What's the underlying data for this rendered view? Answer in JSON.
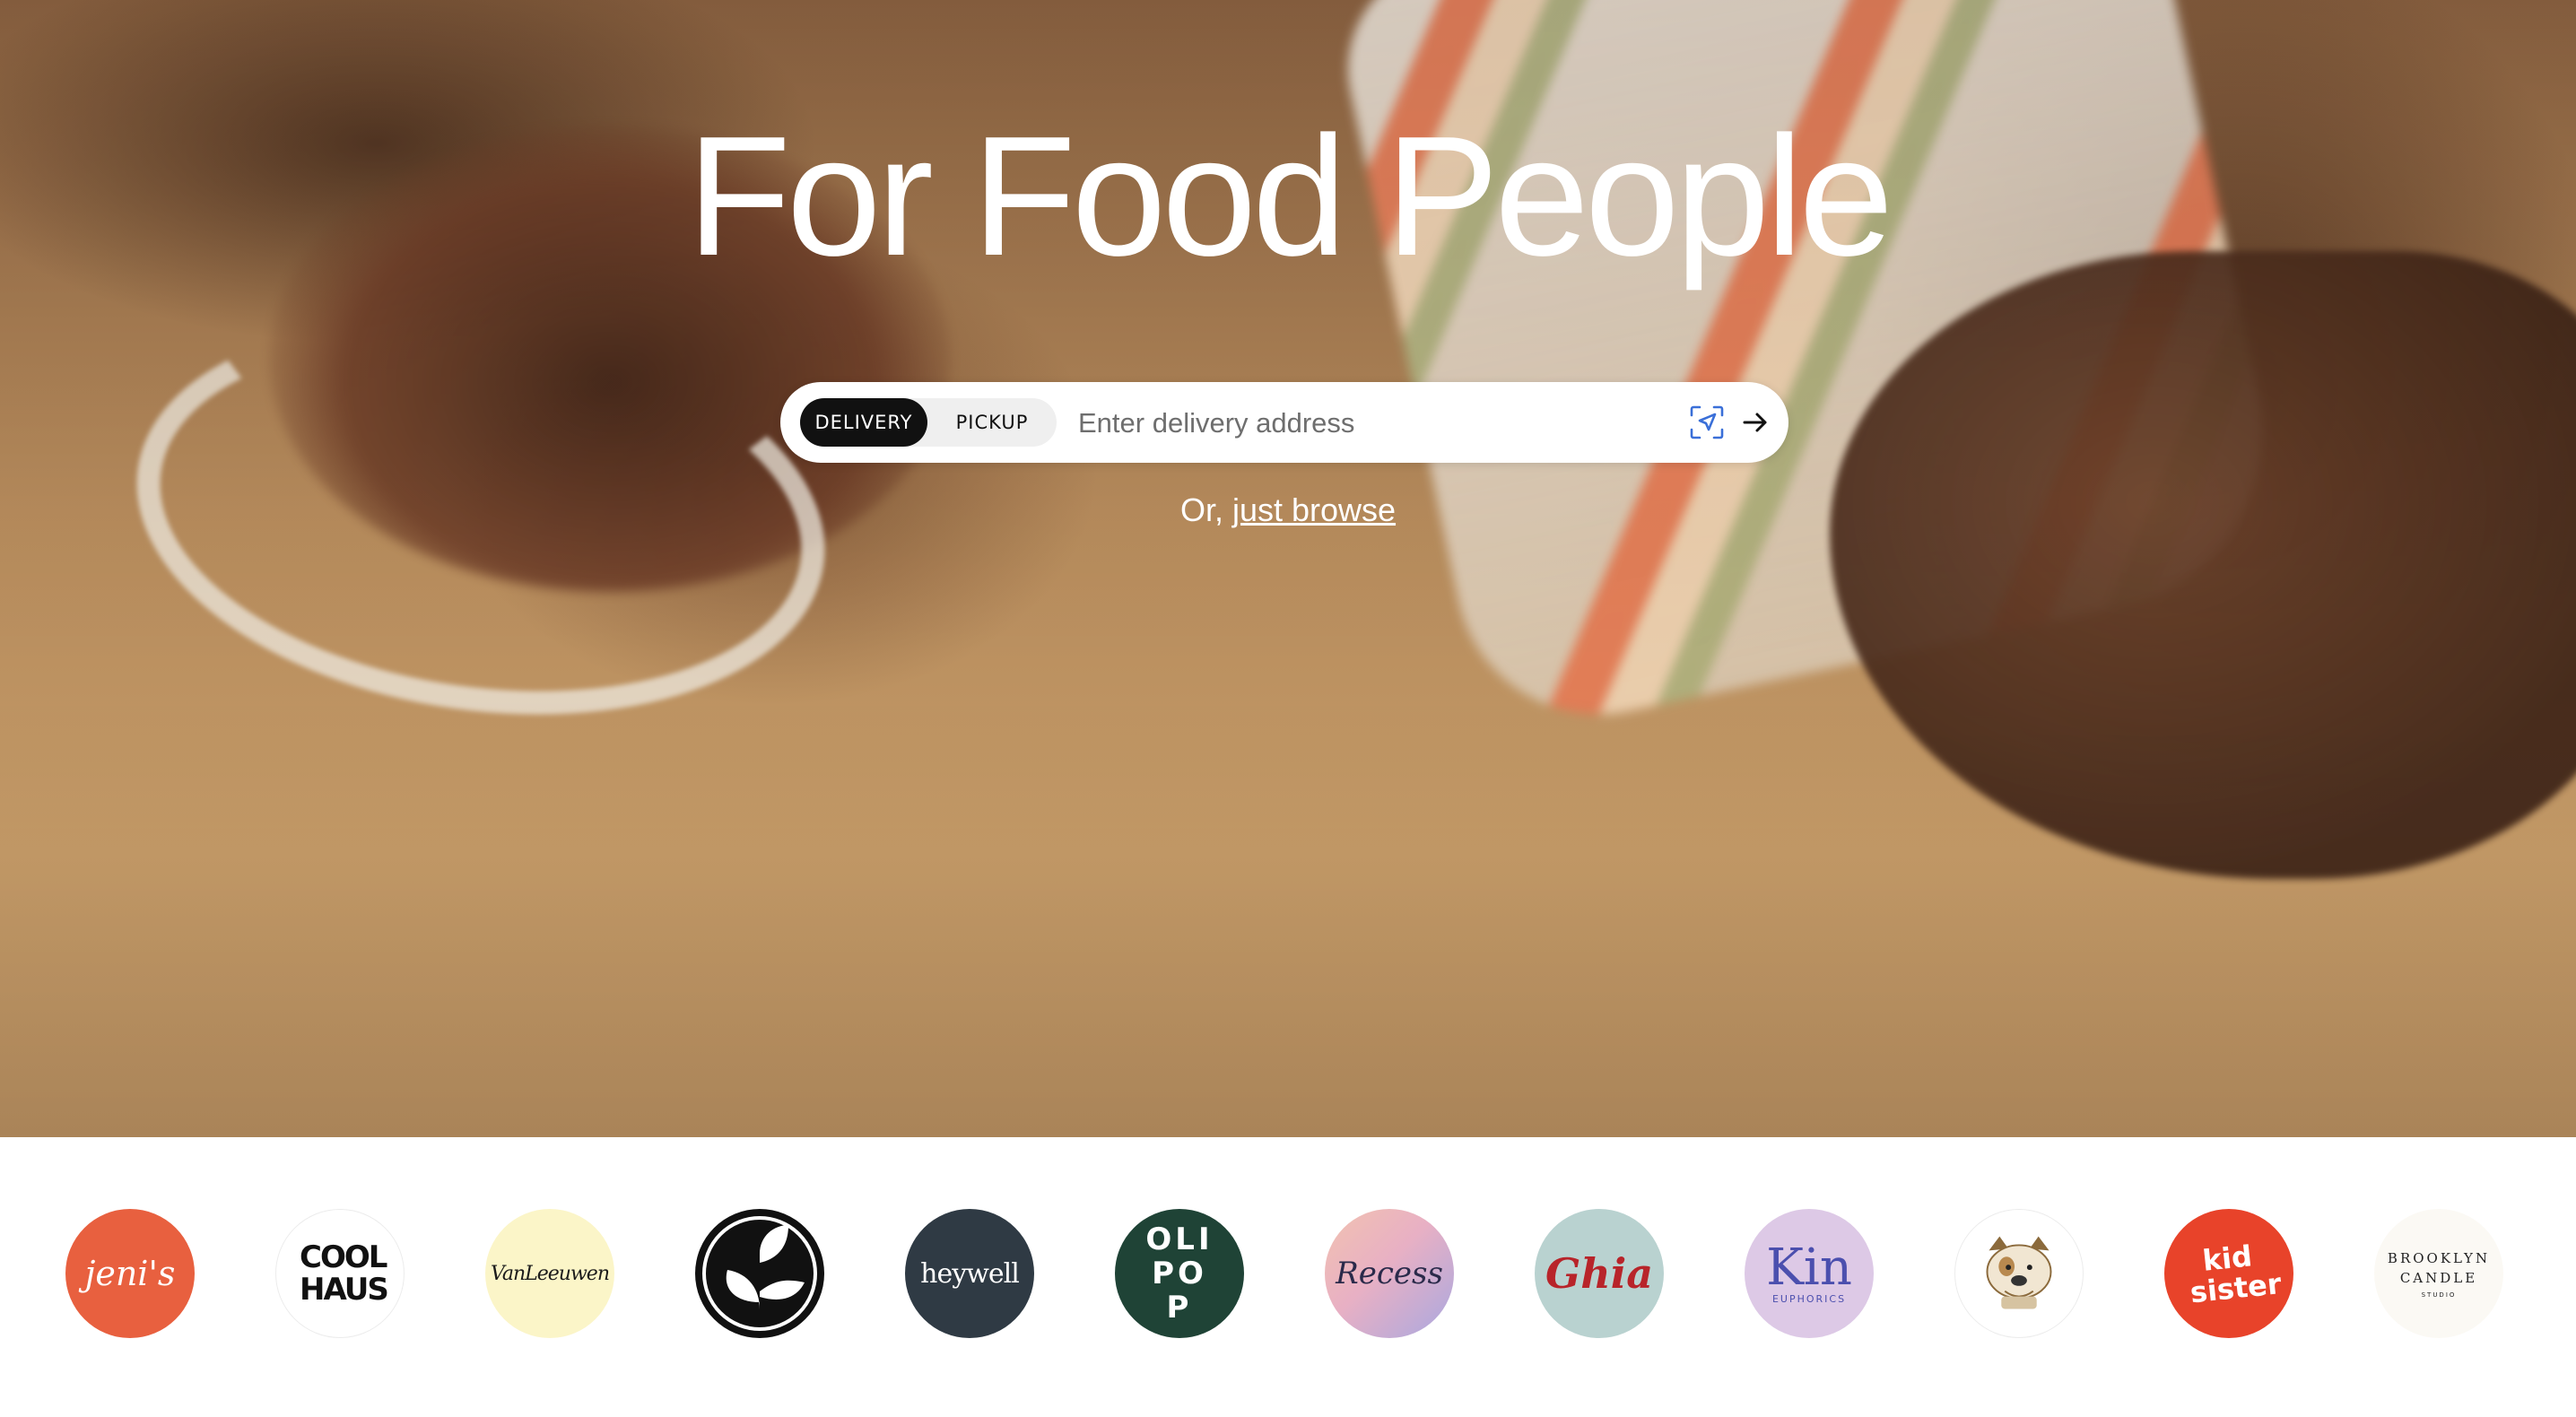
{
  "hero": {
    "headline": "For Food People",
    "search": {
      "mode_delivery": "DELIVERY",
      "mode_pickup": "PICKUP",
      "active_mode": "DELIVERY",
      "placeholder": "Enter delivery address",
      "value": ""
    },
    "browse": {
      "prefix": "Or, ",
      "link": "just browse"
    }
  },
  "brands": [
    {
      "label": "jeni's",
      "bg": "#e8603f",
      "fg": "#ffffff"
    },
    {
      "label": "COOL HAUS",
      "bg": "#ffffff",
      "fg": "#111111"
    },
    {
      "label": "VanLeeuwen",
      "bg": "#fbf5c8",
      "fg": "#1b1b1b"
    },
    {
      "label": "",
      "icon": "leaf-icon",
      "bg": "#111111",
      "fg": "#ffffff"
    },
    {
      "label": "heywell",
      "bg": "#2f3a44",
      "fg": "#ffffff"
    },
    {
      "label": "OLIPOP",
      "bg": "#1f4336",
      "fg": "#ffffff"
    },
    {
      "label": "Recess",
      "bg": "#e8b6b6",
      "fg": "#2a2a4a"
    },
    {
      "label": "Ghia",
      "bg": "#b9d2d0",
      "fg": "#b8242a"
    },
    {
      "label": "Kin",
      "sub": "EUPHORICS",
      "bg": "#ddc9e6",
      "fg": "#4b4fae"
    },
    {
      "label": "",
      "icon": "bulldog-icon",
      "bg": "#ffffff",
      "fg": "#8b6a3c"
    },
    {
      "label": "kid sister",
      "bg": "#e8432a",
      "fg": "#ffffff"
    },
    {
      "label": "BROOKLYN CANDLE",
      "sub": "STUDIO",
      "bg": "#fbf9f4",
      "fg": "#222222"
    }
  ],
  "colors": {
    "active_toggle_bg": "#111111",
    "locate_icon": "#3a6fd8"
  }
}
